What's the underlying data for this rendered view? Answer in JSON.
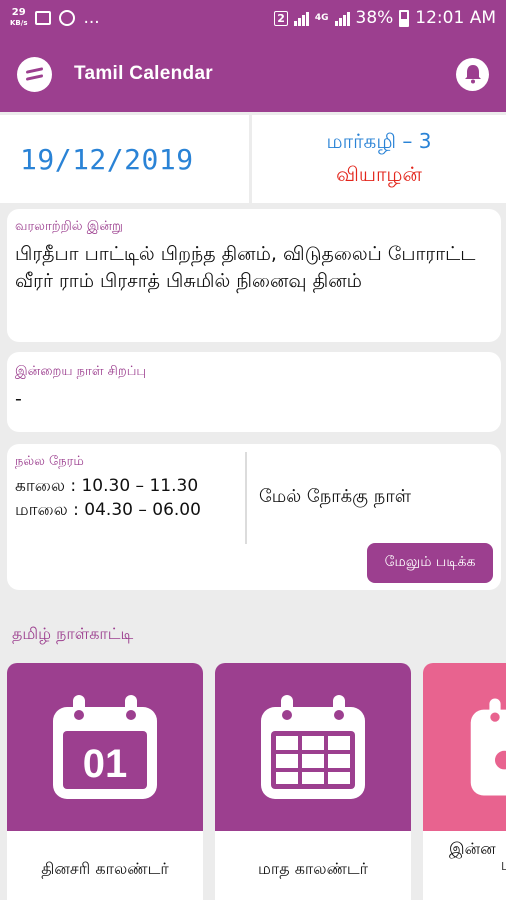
{
  "status_bar": {
    "speed_value": "29",
    "speed_unit": "KB/s",
    "more": "...",
    "sim": "2",
    "network": "4G",
    "battery": "38%",
    "time": "12:01 AM"
  },
  "app_bar": {
    "title": "Tamil Calendar",
    "menu_icon": "menu-icon",
    "notification_icon": "bell-icon"
  },
  "date": {
    "gregorian": "19/12/2019",
    "tamil": "மார்கழி – 3",
    "weekday": "வியாழன்"
  },
  "history": {
    "label": "வரலாற்றில் இன்று",
    "text": "பிரதீபா பாட்டில் பிறந்த தினம், விடுதலைப் போராட்ட வீரர் ராம் பிரசாத் பிசுமில் நினைவு தினம்"
  },
  "special": {
    "label": "இன்றைய நாள் சிறப்பு",
    "text": "-"
  },
  "good_time": {
    "label": "நல்ல நேரம்",
    "morning": "காலை : 10.30 – 11.30",
    "evening": "மாலை : 04.30 – 06.00",
    "day_type": "மேல் நோக்கு நாள்",
    "more_button": "மேலும் படிக்க"
  },
  "section_title": "தமிழ் நாள்காட்டி",
  "tiles": [
    {
      "label": "தினசரி காலண்டர்",
      "icon": "daily-calendar-icon",
      "icon_text": "01"
    },
    {
      "label": "மாத காலண்டர்",
      "icon": "monthly-calendar-icon"
    },
    {
      "label": "இன்ன",
      "sub": "L",
      "icon": "calendar-icon"
    }
  ],
  "colors": {
    "primary": "#9c3f8f",
    "accent_blue": "#2a83d6",
    "accent_red": "#e3261c",
    "tile_pink": "#e8638f"
  }
}
